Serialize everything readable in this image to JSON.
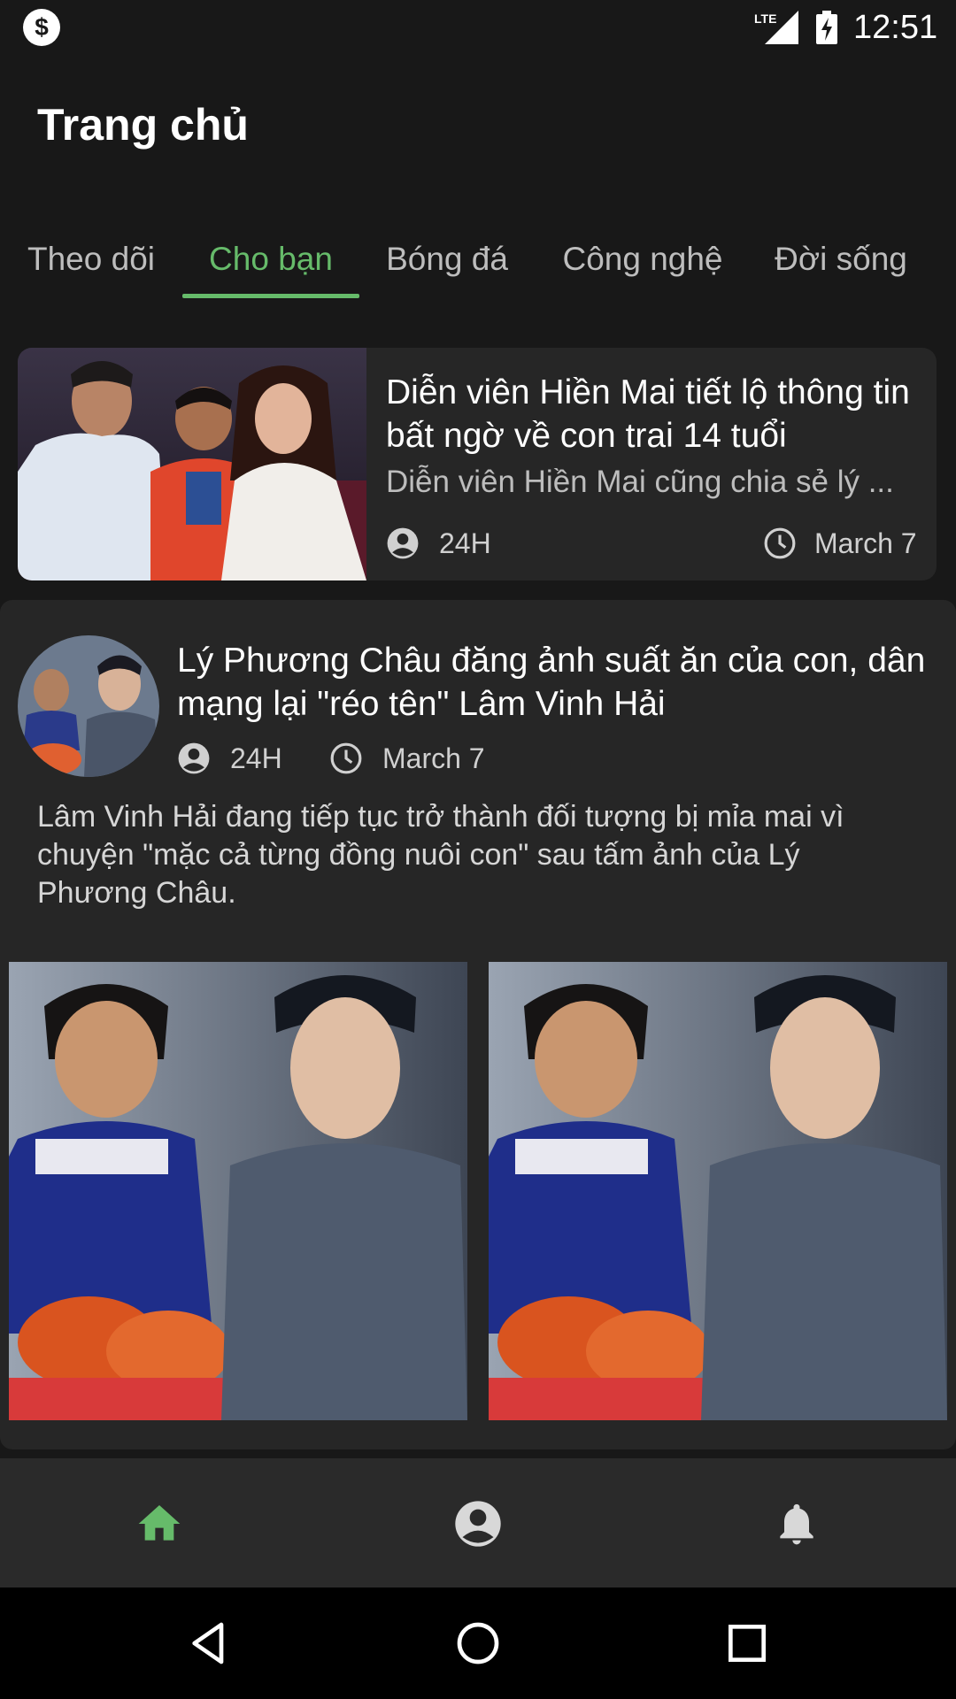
{
  "status_bar": {
    "time": "12:51",
    "network_label": "LTE",
    "app_icon": "dollar-app-icon"
  },
  "header": {
    "title": "Trang chủ"
  },
  "tabs": [
    {
      "label": "Theo dõi",
      "active": false
    },
    {
      "label": "Cho bạn",
      "active": true
    },
    {
      "label": "Bóng đá",
      "active": false
    },
    {
      "label": "Công nghệ",
      "active": false
    },
    {
      "label": "Đời sống",
      "active": false
    }
  ],
  "articles": [
    {
      "title": "Diễn viên Hiền Mai tiết lộ thông tin bất ngờ về con trai 14 tuổi",
      "summary": "Diễn viên Hiền Mai cũng chia sẻ lý ...",
      "source": "24H",
      "date": "March 7",
      "image": "family-photo"
    },
    {
      "title": "Lý Phương Châu đăng ảnh suất ăn của con, dân mạng lại \"réo tên\" Lâm Vinh Hải",
      "summary": "Lâm Vinh Hải đang tiếp tục trở thành đối tượng bị mỉa mai vì chuyện \"mặc cả từng đồng nuôi con\" sau tấm ảnh của Lý Phương Châu.",
      "source": "24H",
      "date": "March 7",
      "image": "girl-with-crabs-and-man-photo"
    }
  ],
  "bottom_nav": [
    {
      "icon": "home-icon",
      "active": true
    },
    {
      "icon": "account-icon",
      "active": false
    },
    {
      "icon": "bell-icon",
      "active": false
    }
  ],
  "system_nav": [
    {
      "icon": "back-icon"
    },
    {
      "icon": "home-circle-icon"
    },
    {
      "icon": "recents-icon"
    }
  ],
  "colors": {
    "background": "#181818",
    "card": "#262626",
    "accent": "#66bb6a",
    "text_primary": "#ffffff",
    "text_secondary": "#bdbdbd"
  }
}
